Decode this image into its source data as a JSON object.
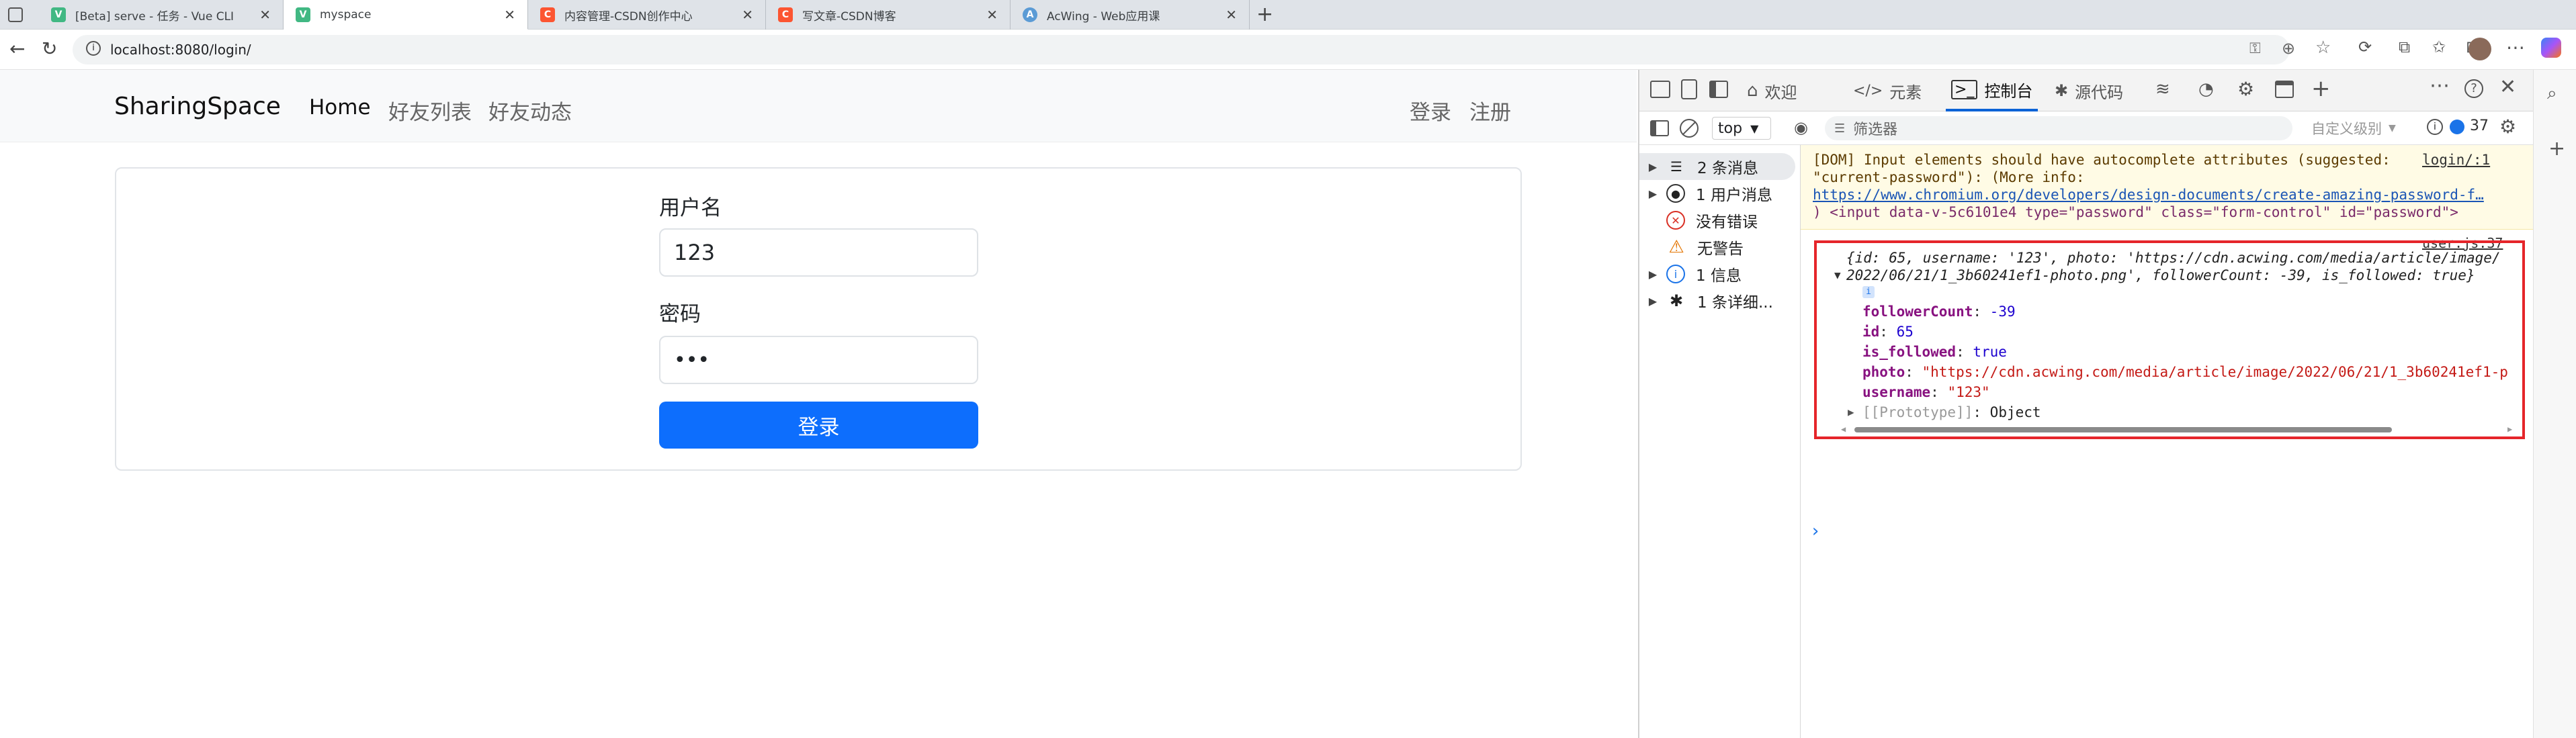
{
  "browser": {
    "tabs": [
      {
        "label": "[Beta] serve - 任务 - Vue CLI",
        "icon": "vue-icon"
      },
      {
        "label": "myspace",
        "icon": "vue-icon"
      },
      {
        "label": "内容管理-CSDN创作中心",
        "icon": "csdn-icon"
      },
      {
        "label": "写文章-CSDN博客",
        "icon": "csdn-icon"
      },
      {
        "label": "AcWing - Web应用课",
        "icon": "acwing-icon"
      }
    ],
    "url": "localhost:8080/login/"
  },
  "navbar": {
    "brand": "SharingSpace",
    "home": "Home",
    "friend_list": "好友列表",
    "friend_feed": "好友动态",
    "login": "登录",
    "register": "注册"
  },
  "form": {
    "username_label": "用户名",
    "username_value": "123",
    "password_label": "密码",
    "password_value": "•••",
    "submit": "登录"
  },
  "devtools": {
    "tabs": [
      "欢迎",
      "元素",
      "控制台",
      "源代码"
    ],
    "context": "top",
    "filter_placeholder": "筛选器",
    "levels": "自定义级别",
    "issue_count": "37",
    "sidebar": [
      "2 条消息",
      "1 用户消息",
      "没有错误",
      "无警告",
      "1 信息",
      "1 条详细..."
    ],
    "warning": {
      "line1": "[DOM] Input elements should have autocomplete attributes (suggested:",
      "source": "login/:1",
      "line2": "\"current-password\"): (More info:",
      "link": "https://www.chromium.org/developers/design-documents/create-amazing-password-f…",
      "line4": ")   <input data-v-5c6101e4 type=\"password\" class=\"form-control\" id=\"password\">"
    },
    "log": {
      "source": "user.js:37",
      "summary1": "{id: 65, username: '123', photo: 'https://cdn.acwing.com/media/article/image/",
      "summary2": "2022/06/21/1_3b60241ef1-photo.png', followerCount: -39, is_followed: true}",
      "props": [
        {
          "key": "followerCount",
          "value": "-39"
        },
        {
          "key": "id",
          "value": "65"
        },
        {
          "key": "is_followed",
          "value": "true"
        },
        {
          "key": "photo",
          "value": "\"https://cdn.acwing.com/media/article/image/2022/06/21/1_3b60241ef1-p"
        },
        {
          "key": "username",
          "value": "\"123\""
        }
      ],
      "prototype_key": "[[Prototype]]",
      "prototype_value": "Object"
    },
    "prompt": "›"
  }
}
